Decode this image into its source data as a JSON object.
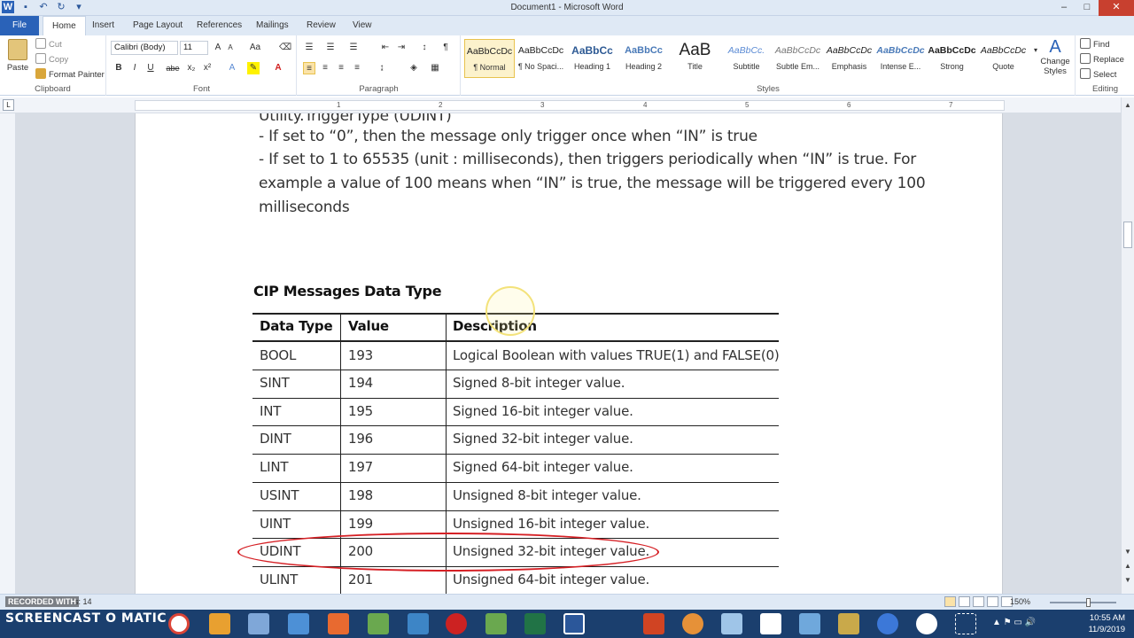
{
  "window": {
    "title": "Document1 - Microsoft Word",
    "controls": [
      "–",
      "□",
      "✕"
    ]
  },
  "ribbon_tabs": [
    "File",
    "Home",
    "Insert",
    "Page Layout",
    "References",
    "Mailings",
    "Review",
    "View"
  ],
  "active_tab": "Home",
  "clipboard": {
    "paste_label": "Paste",
    "cut_label": "Cut",
    "copy_label": "Copy",
    "format_painter_label": "Format Painter",
    "group_label": "Clipboard"
  },
  "font": {
    "family": "Calibri (Body)",
    "size": "11",
    "group_label": "Font",
    "buttons": [
      "B",
      "I",
      "U",
      "abe",
      "x₂",
      "x²"
    ]
  },
  "paragraph": {
    "group_label": "Paragraph"
  },
  "styles": {
    "group_label": "Styles",
    "items": [
      {
        "sample": "AaBbCcDc",
        "name": "¶ Normal"
      },
      {
        "sample": "AaBbCcDc",
        "name": "¶ No Spaci..."
      },
      {
        "sample": "AaBbCc",
        "name": "Heading 1"
      },
      {
        "sample": "AaBbCc",
        "name": "Heading 2"
      },
      {
        "sample": "AaB",
        "name": "Title"
      },
      {
        "sample": "AaBbCc.",
        "name": "Subtitle"
      },
      {
        "sample": "AaBbCcDc",
        "name": "Subtle Em..."
      },
      {
        "sample": "AaBbCcDc",
        "name": "Emphasis"
      },
      {
        "sample": "AaBbCcDc",
        "name": "Intense E..."
      },
      {
        "sample": "AaBbCcDc",
        "name": "Strong"
      },
      {
        "sample": "AaBbCcDc",
        "name": "Quote"
      }
    ],
    "change_styles_label": "Change Styles"
  },
  "editing": {
    "group_label": "Editing",
    "find_label": "Find",
    "replace_label": "Replace",
    "select_label": "Select"
  },
  "ruler_numbers": [
    "1",
    "2",
    "3",
    "4",
    "5",
    "6",
    "7"
  ],
  "document": {
    "partial_line": "Utility.TriggerType (UDINT)",
    "lines": [
      "- If set to “0”, then the message only trigger once when “IN” is true",
      "- If set to 1 to 65535 (unit : milliseconds), then triggers periodically when “IN” is true. For",
      "example a value of 100 means when “IN” is true, the message will be triggered every 100",
      "milliseconds"
    ],
    "table_title": "CIP Messages Data Type",
    "table_headers": [
      "Data Type",
      "Value",
      "Description"
    ],
    "table_rows": [
      [
        "BOOL",
        "193",
        "Logical Boolean with values TRUE(1) and FALSE(0)"
      ],
      [
        "SINT",
        "194",
        "Signed 8-bit integer value."
      ],
      [
        "INT",
        "195",
        "Signed 16-bit integer value."
      ],
      [
        "DINT",
        "196",
        "Signed 32-bit integer value."
      ],
      [
        "LINT",
        "197",
        "Signed 64-bit integer value."
      ],
      [
        "USINT",
        "198",
        "Unsigned 8-bit integer value."
      ],
      [
        "UINT",
        "199",
        "Unsigned 16-bit integer value."
      ],
      [
        "UDINT",
        "200",
        "Unsigned 32-bit integer value."
      ],
      [
        "ULINT",
        "201",
        "Unsigned 64-bit integer value."
      ]
    ],
    "highlighted_row": "UDINT"
  },
  "statusbar": {
    "left_text": "RECORDED WITH",
    "page_info": "s: 14",
    "zoom": "150%"
  },
  "taskbar": {
    "watermark": "SCREENCAST O MATIC",
    "time": "10:55 AM",
    "date": "11/9/2019"
  },
  "colors": {
    "accent": "#2a62b8",
    "annotation_red": "#d51f24",
    "cursor_highlight": "#f3e27a"
  }
}
